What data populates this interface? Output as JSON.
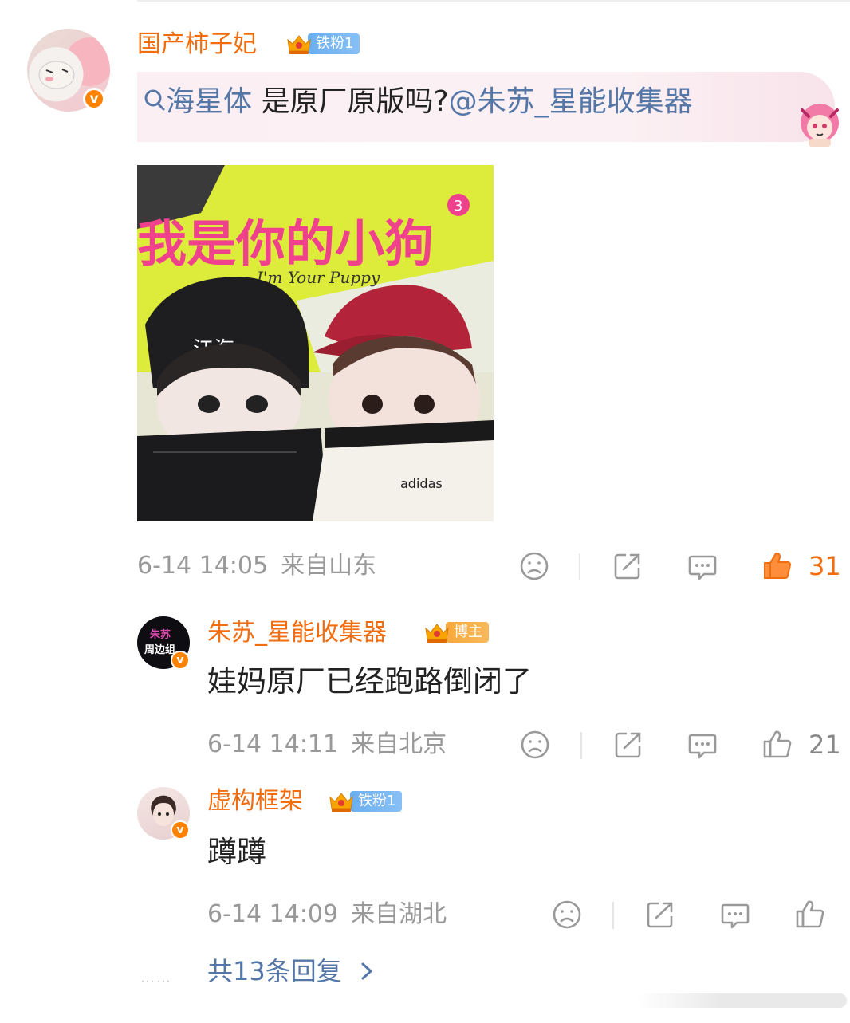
{
  "main_comment": {
    "username": "国产柿子妃",
    "fan_badge": "铁粉1",
    "search_keyword": "海星体",
    "text": " 是原厂原版吗?",
    "mention": "@朱苏_星能收集器",
    "meta_time": "6-14 14:05",
    "meta_location": "来自山东",
    "like_count": "31"
  },
  "replies": [
    {
      "username": "朱苏_星能收集器",
      "badge": "博主",
      "avatar_text_top": "朱苏",
      "avatar_text_bottom": "周边组",
      "text": "娃妈原厂已经跑路倒闭了",
      "meta_time": "6-14 14:11",
      "meta_location": "来自北京",
      "like_count": "21"
    },
    {
      "username": "虚构框架",
      "badge": "铁粉1",
      "text": "蹲蹲",
      "meta_time": "6-14 14:09",
      "meta_location": "来自湖北",
      "like_count": ""
    }
  ],
  "more_replies": "共13条回复",
  "more_dots": "……",
  "photo": {
    "title_cn": "我是你的小狗",
    "title_sup": "3",
    "title_en": "I'm Your Puppy",
    "hat_text": "江海",
    "jacket_logo": "adidas"
  },
  "colors": {
    "username": "#f26d0f",
    "link": "#5477a8",
    "meta": "#999999",
    "liked": "#f26d0f",
    "verified_badge": "#ff8200"
  },
  "icons": [
    "search-icon",
    "dislike-icon",
    "share-icon",
    "comment-icon",
    "like-icon",
    "verified-icon",
    "crown-icon",
    "chevron-right-icon"
  ]
}
